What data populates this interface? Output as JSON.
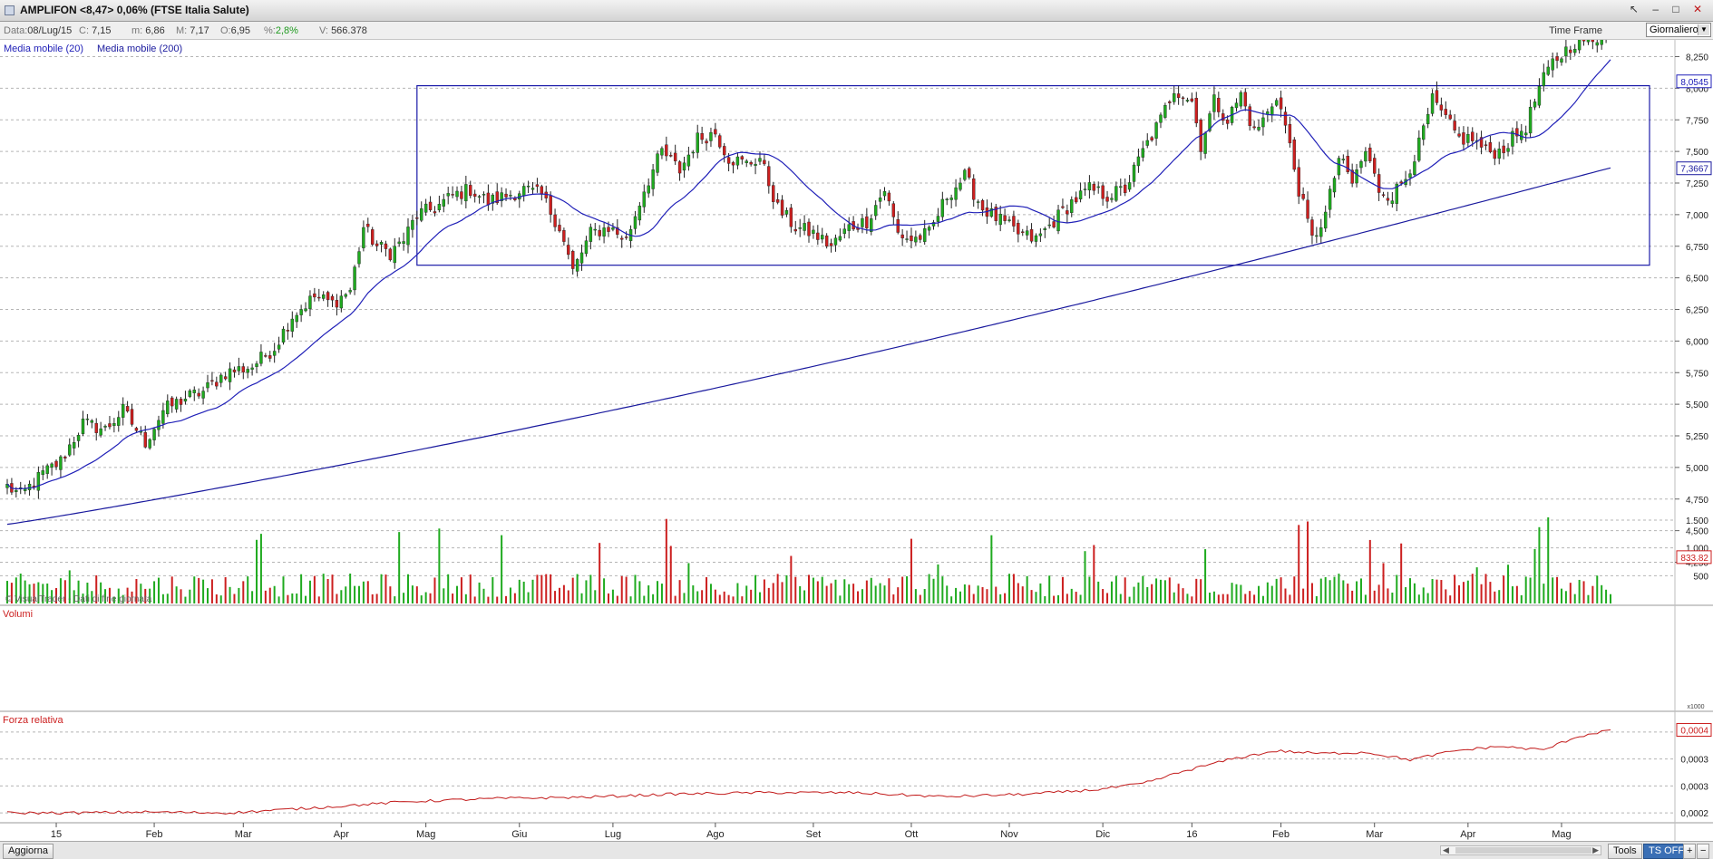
{
  "window": {
    "title": "AMPLIFON <8,47> 0,06%  (FTSE Italia Salute)",
    "controls": [
      "↖",
      "–",
      "□",
      "✕"
    ]
  },
  "infobar": {
    "data_label": "Data:",
    "data_value": "08/Lug/15",
    "c_label": "C:",
    "c_value": "7,15",
    "m_label": "m:",
    "m_value": "6,86",
    "M_label": "M:",
    "M_value": "7,17",
    "o_label": "O:",
    "o_value": "6,95",
    "pct_label": "%:",
    "pct_value": "2,8%",
    "v_label": "V:",
    "v_value": "566.378",
    "time_frame_label": "Time Frame",
    "time_frame_value": "Giornaliero"
  },
  "legend": {
    "ma20": "Media mobile (20)",
    "ma200": "Media mobile (200)",
    "watermark": "© VisualTrader - Dati di fine giornata",
    "volume_title": "Volumi",
    "rs_title": "Forza relativa",
    "volume_multiplier": "x1000"
  },
  "colors": {
    "up": "#1faa1f",
    "down": "#cc1f1f",
    "ma20": "#2020b8",
    "ma200": "#1a1a9e",
    "rectangle": "#1a1aa8",
    "rs_line": "#c21a1a",
    "last_price_bg": "#ffff00"
  },
  "statusbar": {
    "aggiorna": "Aggiorna",
    "tools": "Tools",
    "ts_off": "TS OFF",
    "plus": "+",
    "minus": "−"
  },
  "chart_data": [
    {
      "type": "candlestick",
      "ylim": [
        4.25,
        8.5
      ],
      "y_ticks": [
        "8,250",
        "8,000",
        "7,750",
        "7,500",
        "7,250",
        "7,000",
        "6,750",
        "6,500",
        "6,250",
        "6,000",
        "5,750",
        "5,500",
        "5,250",
        "5,000",
        "4,750",
        "4,500",
        "4,250"
      ],
      "y_tick_values": [
        8.25,
        8.0,
        7.75,
        7.5,
        7.25,
        7.0,
        6.75,
        6.5,
        6.25,
        6.0,
        5.75,
        5.5,
        5.25,
        5.0,
        4.75,
        4.5,
        4.25
      ],
      "x_months": [
        {
          "label": "15",
          "day": 11
        },
        {
          "label": "Feb",
          "day": 33
        },
        {
          "label": "Mar",
          "day": 53
        },
        {
          "label": "Apr",
          "day": 75
        },
        {
          "label": "Mag",
          "day": 94
        },
        {
          "label": "Giu",
          "day": 115
        },
        {
          "label": "Lug",
          "day": 136
        },
        {
          "label": "Ago",
          "day": 159
        },
        {
          "label": "Set",
          "day": 181
        },
        {
          "label": "Ott",
          "day": 203
        },
        {
          "label": "Nov",
          "day": 225
        },
        {
          "label": "Dic",
          "day": 246
        },
        {
          "label": "16",
          "day": 266
        },
        {
          "label": "Feb",
          "day": 286
        },
        {
          "label": "Mar",
          "day": 307
        },
        {
          "label": "Apr",
          "day": 328
        },
        {
          "label": "Mag",
          "day": 349
        }
      ],
      "trading_days": 361,
      "anchors": [
        [
          0,
          4.85
        ],
        [
          3,
          4.78
        ],
        [
          8,
          4.95
        ],
        [
          12,
          5.05
        ],
        [
          17,
          5.35
        ],
        [
          22,
          5.3
        ],
        [
          26,
          5.45
        ],
        [
          31,
          5.2
        ],
        [
          35,
          5.45
        ],
        [
          40,
          5.55
        ],
        [
          44,
          5.6
        ],
        [
          49,
          5.75
        ],
        [
          55,
          5.8
        ],
        [
          60,
          5.95
        ],
        [
          64,
          6.2
        ],
        [
          69,
          6.35
        ],
        [
          73,
          6.3
        ],
        [
          77,
          6.4
        ],
        [
          80,
          6.9
        ],
        [
          83,
          6.75
        ],
        [
          86,
          6.7
        ],
        [
          89,
          6.8
        ],
        [
          92,
          7.0
        ],
        [
          96,
          7.05
        ],
        [
          100,
          7.15
        ],
        [
          104,
          7.2
        ],
        [
          108,
          7.1
        ],
        [
          112,
          7.15
        ],
        [
          116,
          7.2
        ],
        [
          120,
          7.15
        ],
        [
          124,
          6.9
        ],
        [
          127,
          6.55
        ],
        [
          131,
          6.85
        ],
        [
          135,
          6.9
        ],
        [
          139,
          6.8
        ],
        [
          143,
          7.2
        ],
        [
          147,
          7.5
        ],
        [
          151,
          7.35
        ],
        [
          155,
          7.6
        ],
        [
          159,
          7.65
        ],
        [
          162,
          7.45
        ],
        [
          166,
          7.4
        ],
        [
          169,
          7.45
        ],
        [
          173,
          7.05
        ],
        [
          177,
          6.9
        ],
        [
          181,
          6.85
        ],
        [
          185,
          6.75
        ],
        [
          189,
          6.9
        ],
        [
          193,
          6.95
        ],
        [
          197,
          7.2
        ],
        [
          200,
          6.85
        ],
        [
          203,
          6.8
        ],
        [
          207,
          6.85
        ],
        [
          211,
          7.15
        ],
        [
          215,
          7.3
        ],
        [
          219,
          7.05
        ],
        [
          223,
          6.95
        ],
        [
          227,
          6.85
        ],
        [
          231,
          6.8
        ],
        [
          235,
          6.95
        ],
        [
          239,
          7.1
        ],
        [
          243,
          7.2
        ],
        [
          247,
          7.15
        ],
        [
          251,
          7.2
        ],
        [
          255,
          7.5
        ],
        [
          259,
          7.75
        ],
        [
          262,
          8.0
        ],
        [
          266,
          7.9
        ],
        [
          268,
          7.55
        ],
        [
          271,
          7.9
        ],
        [
          274,
          7.75
        ],
        [
          277,
          7.95
        ],
        [
          280,
          7.65
        ],
        [
          283,
          7.8
        ],
        [
          285,
          7.95
        ],
        [
          287,
          7.7
        ],
        [
          290,
          7.2
        ],
        [
          293,
          6.8
        ],
        [
          296,
          7.0
        ],
        [
          299,
          7.45
        ],
        [
          302,
          7.25
        ],
        [
          305,
          7.5
        ],
        [
          308,
          7.2
        ],
        [
          311,
          7.15
        ],
        [
          314,
          7.3
        ],
        [
          317,
          7.55
        ],
        [
          320,
          7.9
        ],
        [
          323,
          7.75
        ],
        [
          326,
          7.6
        ],
        [
          329,
          7.6
        ],
        [
          332,
          7.5
        ],
        [
          335,
          7.5
        ],
        [
          338,
          7.6
        ],
        [
          341,
          7.7
        ],
        [
          344,
          8.0
        ],
        [
          347,
          8.2
        ],
        [
          350,
          8.3
        ],
        [
          353,
          8.4
        ],
        [
          356,
          8.35
        ],
        [
          359,
          8.47
        ],
        [
          360,
          8.47
        ]
      ],
      "last_price_label": "8,470",
      "ma20_label": "8,0545",
      "ma200_label": "7,3667",
      "consolidation_range": {
        "y_low": 6.6,
        "y_high": 8.02,
        "day_start": 92,
        "day_end": 360
      }
    },
    {
      "type": "bar",
      "title": "Volumi",
      "y_ticks": [
        "1.500",
        "1.000",
        "500"
      ],
      "y_tick_values": [
        1500,
        1000,
        500
      ],
      "ylim": [
        0,
        1500
      ],
      "last_label": "833.82",
      "x": "same trading days as price panel"
    },
    {
      "type": "line",
      "title": "Forza relativa",
      "y_ticks": [
        "0,0004",
        "0,0003",
        "0,0003",
        "0,0002"
      ],
      "y_tick_values": [
        0.00044,
        0.00038,
        0.00032,
        0.00026
      ],
      "ylim": [
        0.00024,
        0.00048
      ],
      "last_label": "0,0004",
      "anchors": [
        [
          0,
          0.00026
        ],
        [
          15,
          0.00026
        ],
        [
          30,
          0.000262
        ],
        [
          50,
          0.00026
        ],
        [
          70,
          0.000272
        ],
        [
          90,
          0.000285
        ],
        [
          110,
          0.000292
        ],
        [
          130,
          0.000295
        ],
        [
          150,
          0.000302
        ],
        [
          170,
          0.000305
        ],
        [
          190,
          0.000305
        ],
        [
          210,
          0.000296
        ],
        [
          230,
          0.000302
        ],
        [
          245,
          0.000312
        ],
        [
          255,
          0.000325
        ],
        [
          265,
          0.000355
        ],
        [
          275,
          0.00038
        ],
        [
          285,
          0.000398
        ],
        [
          295,
          0.000392
        ],
        [
          305,
          0.000395
        ],
        [
          315,
          0.000378
        ],
        [
          325,
          0.000398
        ],
        [
          335,
          0.000408
        ],
        [
          345,
          0.0004
        ],
        [
          352,
          0.000428
        ],
        [
          360,
          0.000445
        ]
      ]
    }
  ]
}
